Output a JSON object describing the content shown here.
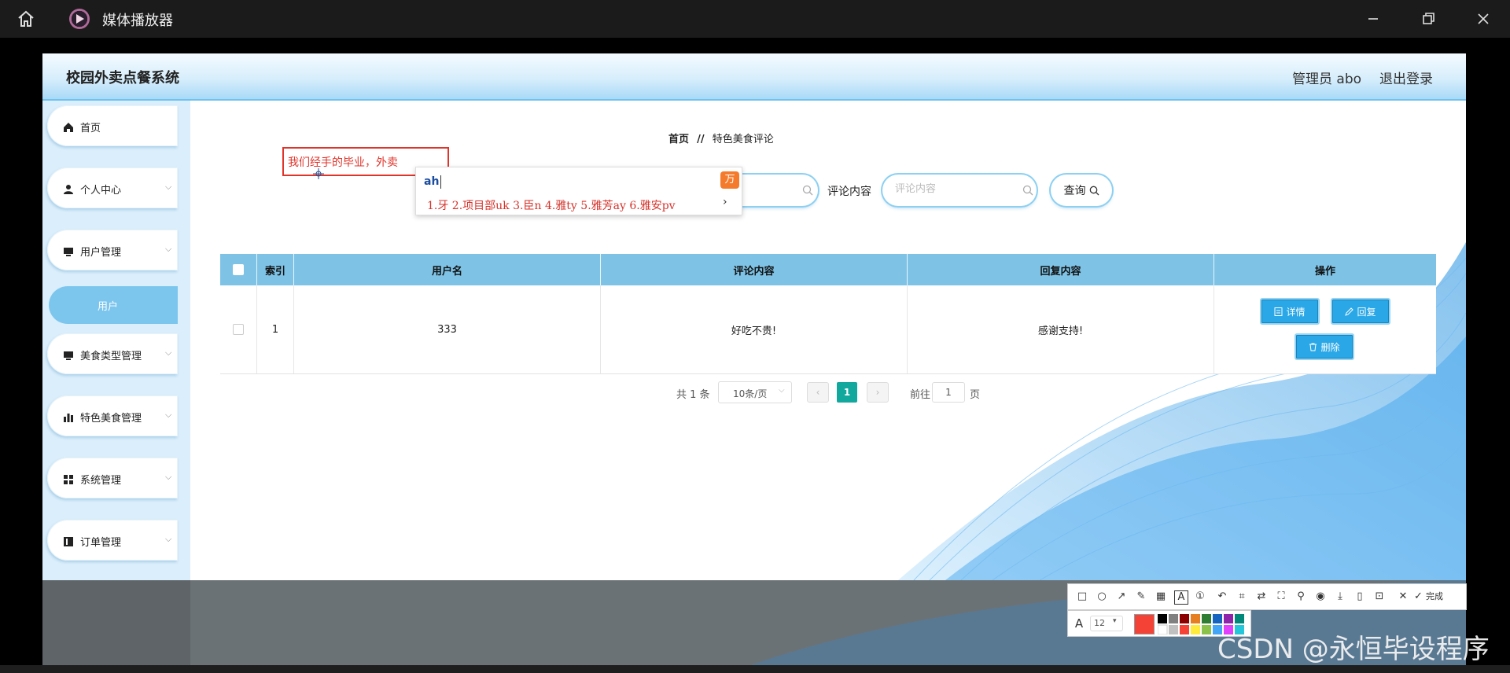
{
  "window": {
    "title": "媒体播放器"
  },
  "app": {
    "system_name": "校园外卖点餐系统",
    "admin": "管理员 abo",
    "logout": "退出登录"
  },
  "sidebar": {
    "items": [
      {
        "label": "首页",
        "icon": "home-icon"
      },
      {
        "label": "个人中心",
        "icon": "user-icon"
      },
      {
        "label": "用户管理",
        "icon": "monitor-icon"
      },
      {
        "label": "用户",
        "icon": ""
      },
      {
        "label": "美食类型管理",
        "icon": "monitor-icon"
      },
      {
        "label": "特色美食管理",
        "icon": "bar-chart-icon"
      },
      {
        "label": "系统管理",
        "icon": "grid-icon"
      },
      {
        "label": "订单管理",
        "icon": "book-icon"
      }
    ]
  },
  "breadcrumb": {
    "home": "首页",
    "sep": "//",
    "current": "特色美食评论"
  },
  "search": {
    "comment_label": "评论内容",
    "comment_placeholder": "评论内容",
    "query_button": "查询"
  },
  "table": {
    "columns": [
      "索引",
      "用户名",
      "评论内容",
      "回复内容",
      "操作"
    ],
    "rows": [
      {
        "index": "1",
        "username": "333",
        "comment": "好吃不贵!",
        "reply": "感谢支持!"
      }
    ],
    "actions": {
      "detail": "详情",
      "reply": "回复",
      "delete": "删除"
    }
  },
  "pagination": {
    "total": "共 1 条",
    "page_size": "10条/页",
    "current_page": "1",
    "goto_label": "前往",
    "goto_value": "1",
    "page_suffix": "页"
  },
  "ime": {
    "input_text": "我们经手的毕业，外卖",
    "composition": "ah",
    "candidates": "1.牙  2.项目部uk  3.臣n  4.雅ty  5.雅芳ay  6.雅安pv",
    "badge": "万"
  },
  "snap_toolbar": {
    "done": "完成",
    "font_size": "12"
  },
  "watermark": "CSDN @永恒毕设程序",
  "colors": {
    "accent": "#2aa7e6",
    "header_blue": "#7ec3e6",
    "page_active": "#13a89e",
    "ime_red": "#e0342b",
    "snap_red": "#f44336"
  }
}
